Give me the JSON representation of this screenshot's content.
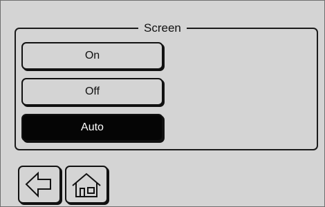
{
  "screen_group": {
    "title": "Screen",
    "options": [
      "On",
      "Off",
      "Auto"
    ],
    "selected": "Auto"
  },
  "navigation": {
    "back_icon": "back-arrow-icon",
    "home_icon": "home-icon"
  },
  "colors": {
    "background": "#d4d4d4",
    "border": "#111111",
    "selected_background": "#050505",
    "selected_text": "#ffffff"
  }
}
